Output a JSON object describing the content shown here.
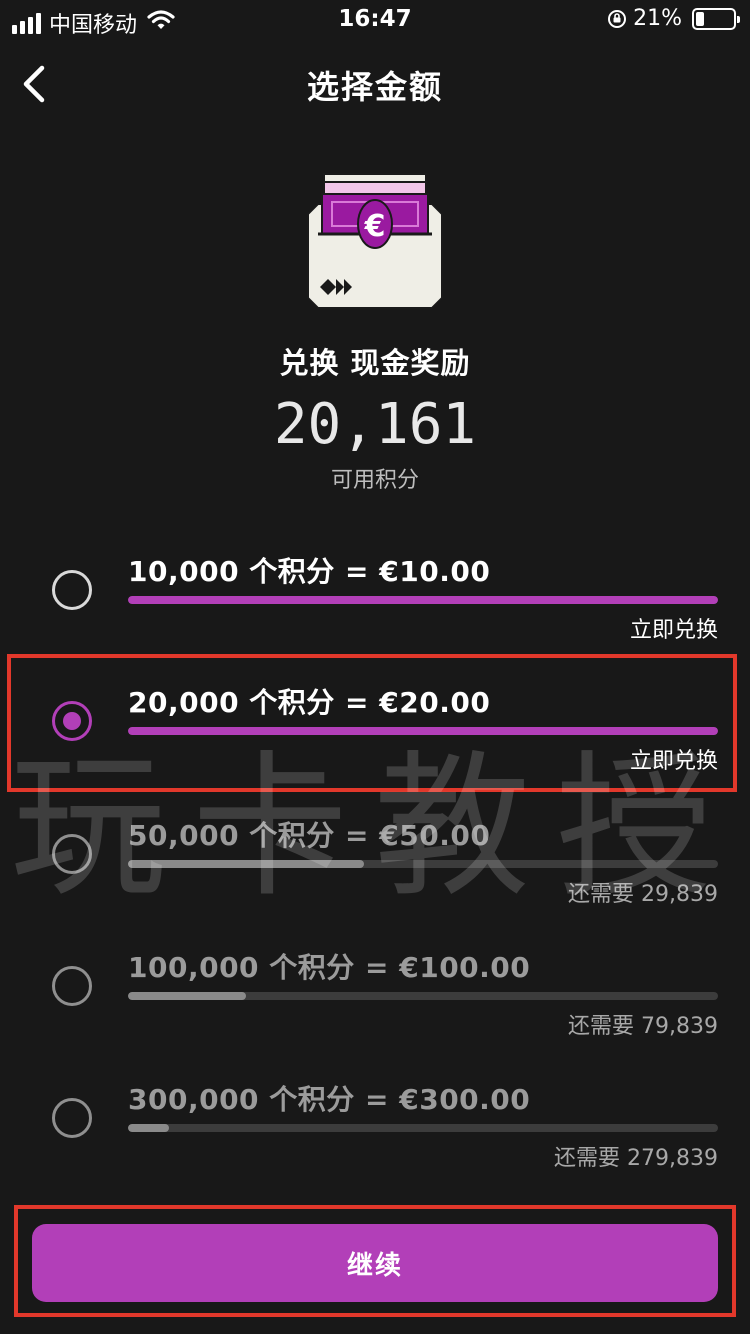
{
  "status_bar": {
    "carrier": "中国移动",
    "time": "16:47",
    "battery": "21%"
  },
  "header": {
    "title": "选择金额"
  },
  "hero": {
    "currency_symbol": "€",
    "title": "兑换 现金奖励",
    "points": "20,161",
    "points_label": "可用积分"
  },
  "options": [
    {
      "label": "10,000 个积分 = €10.00",
      "status": "立即兑换",
      "progress": 1.0,
      "selected": false,
      "available": true
    },
    {
      "label": "20,000 个积分 = €20.00",
      "status": "立即兑换",
      "progress": 1.0,
      "selected": true,
      "available": true
    },
    {
      "label": "50,000 个积分 = €50.00",
      "status": "还需要 29,839",
      "progress": 0.4,
      "selected": false,
      "available": false
    },
    {
      "label": "100,000 个积分 = €100.00",
      "status": "还需要 79,839",
      "progress": 0.2,
      "selected": false,
      "available": false
    },
    {
      "label": "300,000 个积分 = €300.00",
      "status": "还需要 279,839",
      "progress": 0.07,
      "selected": false,
      "available": false
    }
  ],
  "watermark": "玩卡教授",
  "continue_button": {
    "label": "继续"
  },
  "colors": {
    "background": "#181818",
    "accent": "#b23fb8",
    "highlight": "#e2382b"
  }
}
